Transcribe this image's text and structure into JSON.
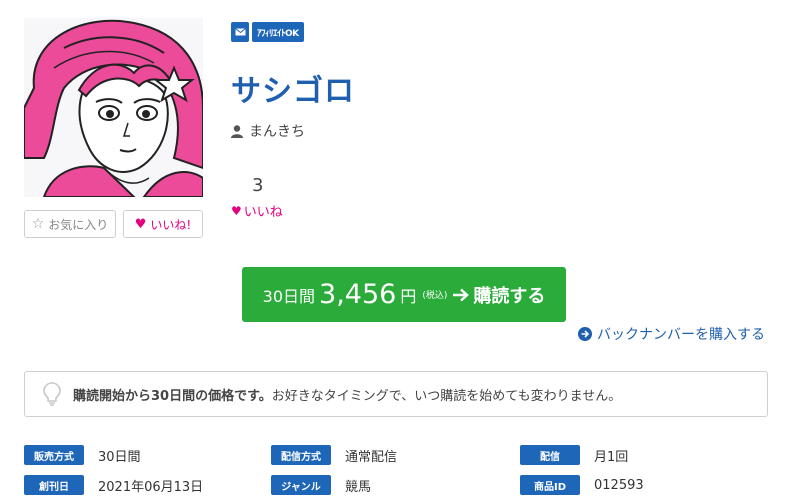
{
  "badges": {
    "mail_icon": "envelope-icon",
    "affiliate": "ｱﾌｨﾘｴｲﾄOK"
  },
  "magazine": {
    "title": "サシゴロ",
    "author": "まんきち"
  },
  "actions": {
    "favorite": "お気に入り",
    "like": "いいね!"
  },
  "likes": {
    "count": "3",
    "label": "いいね"
  },
  "purchase": {
    "period": "30日間",
    "price": "3,456",
    "currency": "円",
    "tax_note": "(税込)",
    "action": "購読する",
    "backnumber": "バックナンバーを購入する"
  },
  "notice": {
    "bold": "購読開始から30日間の価格です。",
    "text": "お好きなタイミングで、いつ購読を始めても変わりません。"
  },
  "details": [
    {
      "label": "販売方式",
      "value": "30日間"
    },
    {
      "label": "配信方式",
      "value": "通常配信"
    },
    {
      "label": "配信",
      "value": "月1回"
    },
    {
      "label": "創刊日",
      "value": "2021年06月13日"
    },
    {
      "label": "ジャンル",
      "value": "競馬"
    },
    {
      "label": "商品ID",
      "value": "012593"
    }
  ],
  "colors": {
    "brand_blue": "#1e5fae",
    "buy_green": "#2aab3a",
    "like_pink": "#e4007f"
  }
}
